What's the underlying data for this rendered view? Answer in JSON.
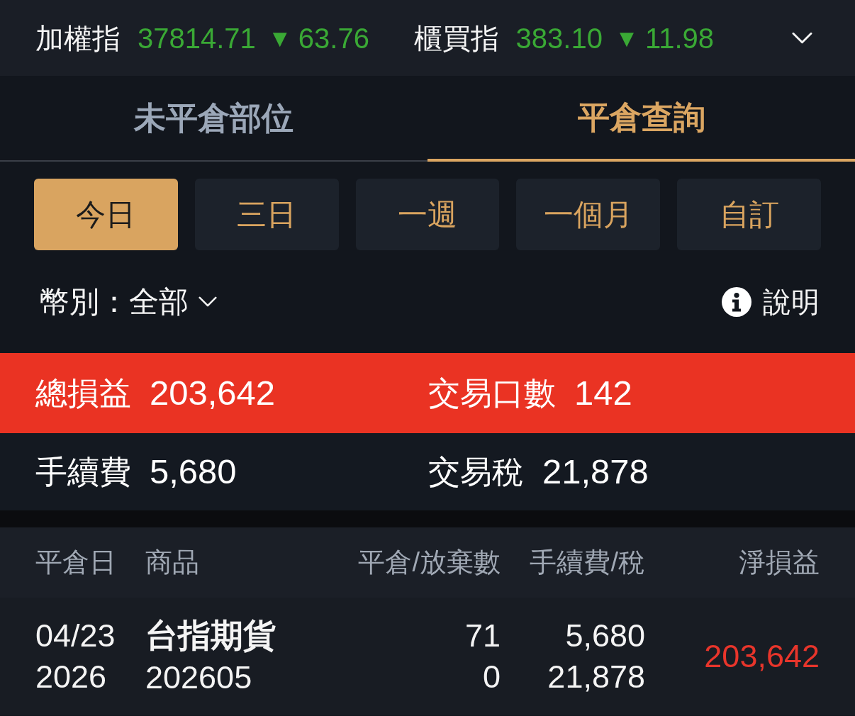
{
  "ticker": {
    "indices": [
      {
        "label": "加權指",
        "value": "37814.71",
        "falling": true,
        "arrow": "▼",
        "change": "63.76"
      },
      {
        "label": "櫃買指",
        "value": "383.10",
        "falling": true,
        "arrow": "▼",
        "change": "11.98"
      }
    ]
  },
  "tabs": [
    {
      "label": "未平倉部位",
      "selected": false
    },
    {
      "label": "平倉查詢",
      "selected": true
    }
  ],
  "periods": [
    {
      "label": "今日",
      "selected": true
    },
    {
      "label": "三日",
      "selected": false
    },
    {
      "label": "一週",
      "selected": false
    },
    {
      "label": "一個月",
      "selected": false
    },
    {
      "label": "自訂",
      "selected": false
    }
  ],
  "currency_filter": {
    "text": "幣別：全部"
  },
  "help": {
    "label": "說明"
  },
  "summary": [
    {
      "highlighted": true,
      "items": [
        {
          "label": "總損益",
          "value": "203,642"
        },
        {
          "label": "交易口數",
          "value": "142"
        }
      ]
    },
    {
      "highlighted": false,
      "items": [
        {
          "label": "手續費",
          "value": "5,680"
        },
        {
          "label": "交易稅",
          "value": "21,878"
        }
      ]
    }
  ],
  "table": {
    "columns": [
      "平倉日",
      "商品",
      "平倉/放棄數",
      "手續費/稅",
      "淨損益"
    ],
    "rows": [
      {
        "close_date": "04/23",
        "close_year": "2026",
        "product": "台指期貨",
        "contract": "202605",
        "closed_qty": "71",
        "abandoned_qty": "0",
        "fee": "5,680",
        "tax": "21,878",
        "net_pnl": "203,642",
        "profit": true
      }
    ]
  }
}
